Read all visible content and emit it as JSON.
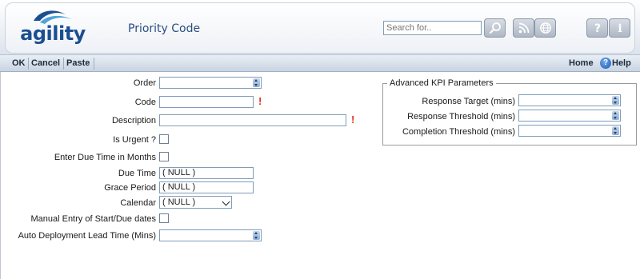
{
  "header": {
    "logo_text": "agility",
    "page_title": "Priority Code",
    "search_placeholder": "Search for..",
    "buttons": [
      "search-icon",
      "rss-icon",
      "globe-icon",
      "help-question-icon",
      "info-icon"
    ]
  },
  "toolbar": {
    "ok_label": "OK",
    "cancel_label": "Cancel",
    "paste_label": "Paste",
    "home_label": "Home",
    "help_label": "Help"
  },
  "form": {
    "order_label": "Order",
    "code_label": "Code",
    "description_label": "Description",
    "is_urgent_label": "Is Urgent ?",
    "due_months_label": "Enter Due Time in Months",
    "due_time_label": "Due Time",
    "due_time_value": "( NULL )",
    "grace_period_label": "Grace Period",
    "grace_period_value": "( NULL )",
    "calendar_label": "Calendar",
    "calendar_value": "( NULL )",
    "manual_entry_label": "Manual Entry of Start/Due dates",
    "auto_deploy_label": "Auto Deployment Lead Time (Mins)",
    "required_mark": "!"
  },
  "kpi": {
    "legend": "Advanced KPI Parameters",
    "response_target_label": "Response Target (mins)",
    "response_threshold_label": "Response Threshold (mins)",
    "completion_threshold_label": "Completion Threshold (mins)"
  },
  "colors": {
    "brand_blue": "#1b4f92",
    "title_blue": "#2a4f80",
    "required_red": "#e0321c"
  }
}
